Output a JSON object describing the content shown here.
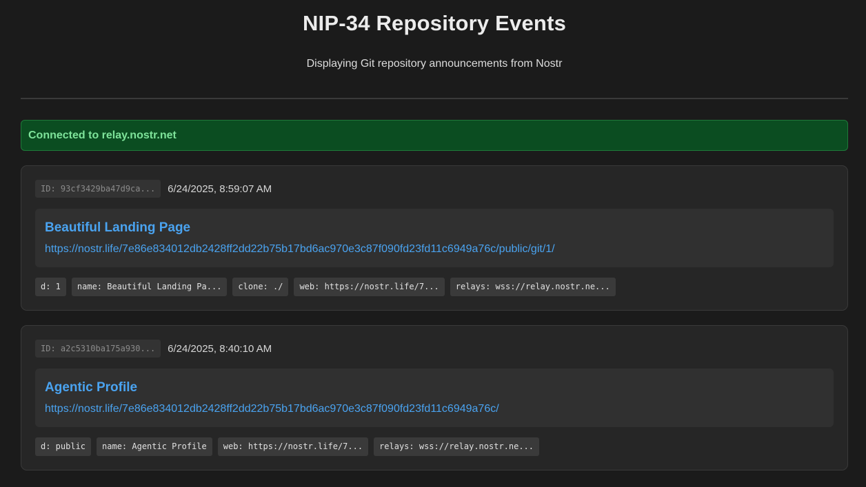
{
  "header": {
    "title": "NIP-34 Repository Events",
    "subtitle": "Displaying Git repository announcements from Nostr"
  },
  "status": {
    "text": "Connected to relay.nostr.net",
    "color": "#0b4d21"
  },
  "events": [
    {
      "id": "ID: 93cf3429ba47d9ca...",
      "date": "6/24/2025, 8:59:07 AM",
      "name": "Beautiful Landing Page",
      "url": "https://nostr.life/7e86e834012db2428ff2dd22b75b17bd6ac970e3c87f090fd23fd11c6949a76c/public/git/1/",
      "tags": [
        "d: 1",
        "name: Beautiful Landing Pa...",
        "clone: ./",
        "web: https://nostr.life/7...",
        "relays: wss://relay.nostr.ne..."
      ]
    },
    {
      "id": "ID: a2c5310ba175a930...",
      "date": "6/24/2025, 8:40:10 AM",
      "name": "Agentic Profile",
      "url": "https://nostr.life/7e86e834012db2428ff2dd22b75b17bd6ac970e3c87f090fd23fd11c6949a76c/",
      "tags": [
        "d: public",
        "name: Agentic Profile",
        "web: https://nostr.life/7...",
        "relays: wss://relay.nostr.ne..."
      ]
    }
  ],
  "colors": {
    "accent": "#4aa3f0",
    "background": "#1b1b1b",
    "success_text": "#7ee39a"
  }
}
